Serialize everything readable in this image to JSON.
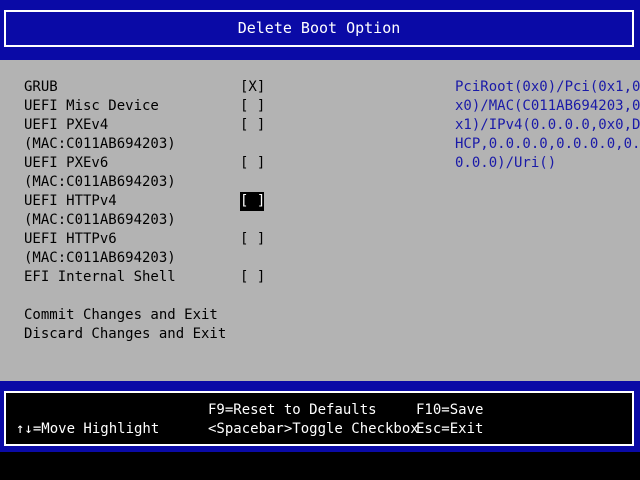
{
  "header": {
    "title": "Delete Boot Option"
  },
  "options": [
    {
      "label": "GRUB",
      "checkbox": "[X]",
      "selected": false
    },
    {
      "label": "UEFI Misc Device",
      "checkbox": "[ ]",
      "selected": false
    },
    {
      "label": "UEFI PXEv4",
      "sublabel": "(MAC:C011AB694203)",
      "checkbox": "[ ]",
      "selected": false
    },
    {
      "label": "UEFI PXEv6",
      "sublabel": "(MAC:C011AB694203)",
      "checkbox": "[ ]",
      "selected": false
    },
    {
      "label": "UEFI HTTPv4",
      "sublabel": "(MAC:C011AB694203)",
      "checkbox": "[ ]",
      "selected": true
    },
    {
      "label": "UEFI HTTPv6",
      "sublabel": "(MAC:C011AB694203)",
      "checkbox": "[ ]",
      "selected": false
    },
    {
      "label": "EFI Internal Shell",
      "checkbox": "[ ]",
      "selected": false
    }
  ],
  "actions": {
    "commit": "Commit Changes and Exit",
    "discard": "Discard Changes and Exit"
  },
  "help_panel": {
    "lines": [
      "PciRoot(0x0)/Pci(0x1,0",
      "x0)/MAC(C011AB694203,0",
      "x1)/IPv4(0.0.0.0,0x0,D",
      "HCP,0.0.0.0,0.0.0.0,0.",
      "0.0.0)/Uri()"
    ]
  },
  "footer": {
    "move_highlight": "↑↓=Move Highlight",
    "reset_defaults": "F9=Reset to Defaults",
    "toggle_checkbox": "<Spacebar>Toggle Checkbox",
    "save": "F10=Save",
    "exit": "Esc=Exit"
  },
  "colors": {
    "frame_blue": "#0a0aa6",
    "panel_gray": "#b3b3b3",
    "help_text_blue": "#1a1aa8",
    "text_black": "#000000",
    "text_white": "#ffffff"
  }
}
